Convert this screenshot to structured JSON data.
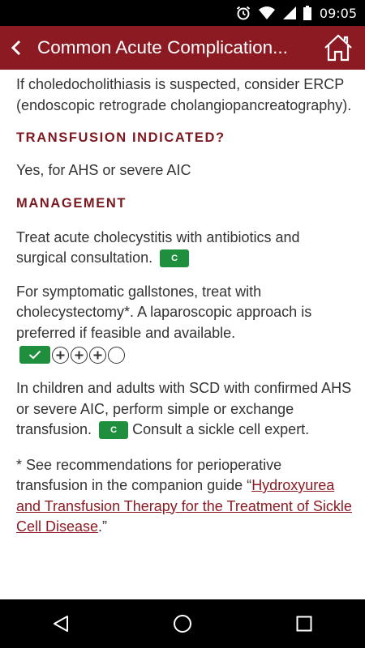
{
  "status_bar": {
    "time": "09:05"
  },
  "app_bar": {
    "title": "Common Acute Complication..."
  },
  "content": {
    "intro": "If choledocholithiasis is suspected, consider ERCP (endoscopic retrograde cholangiopancreatography).",
    "transfusion_heading": "TRANSFUSION INDICATED?",
    "transfusion_text": "Yes, for AHS or severe AIC",
    "management_heading": "MANAGEMENT",
    "management_1": "Treat acute cholecystitis with antibiotics and surgical consultation.",
    "management_1_badge": "C",
    "management_2": "For symptomatic gallstones, treat with cholecystectomy*. A laparoscopic approach is preferred if feasible and available.",
    "management_2_rating": {
      "filled": 1,
      "plus": 3,
      "empty": 1
    },
    "management_3a": "In children and adults with SCD with confirmed AHS or severe AIC, perform simple or exchange transfusion.",
    "management_3_badge": "C",
    "management_3b": "Consult a sickle cell expert.",
    "footnote_prefix": "* See recommendations for perioperative transfusion in the companion guide “",
    "footnote_link": "Hydroxyurea and Transfusion Therapy for the Treatment of Sickle Cell Disease",
    "footnote_suffix": ".”"
  },
  "colors": {
    "app_bar": "#8c1a23",
    "heading": "#7c1820",
    "badge": "#1f8f3d",
    "text": "#333333"
  },
  "icons": {
    "status": [
      "alarm-icon",
      "wifi-icon",
      "signal-icon",
      "battery-icon"
    ],
    "app_bar": [
      "back-arrow-icon",
      "home-icon"
    ],
    "nav": [
      "nav-back-icon",
      "nav-home-icon",
      "nav-recents-icon"
    ]
  }
}
